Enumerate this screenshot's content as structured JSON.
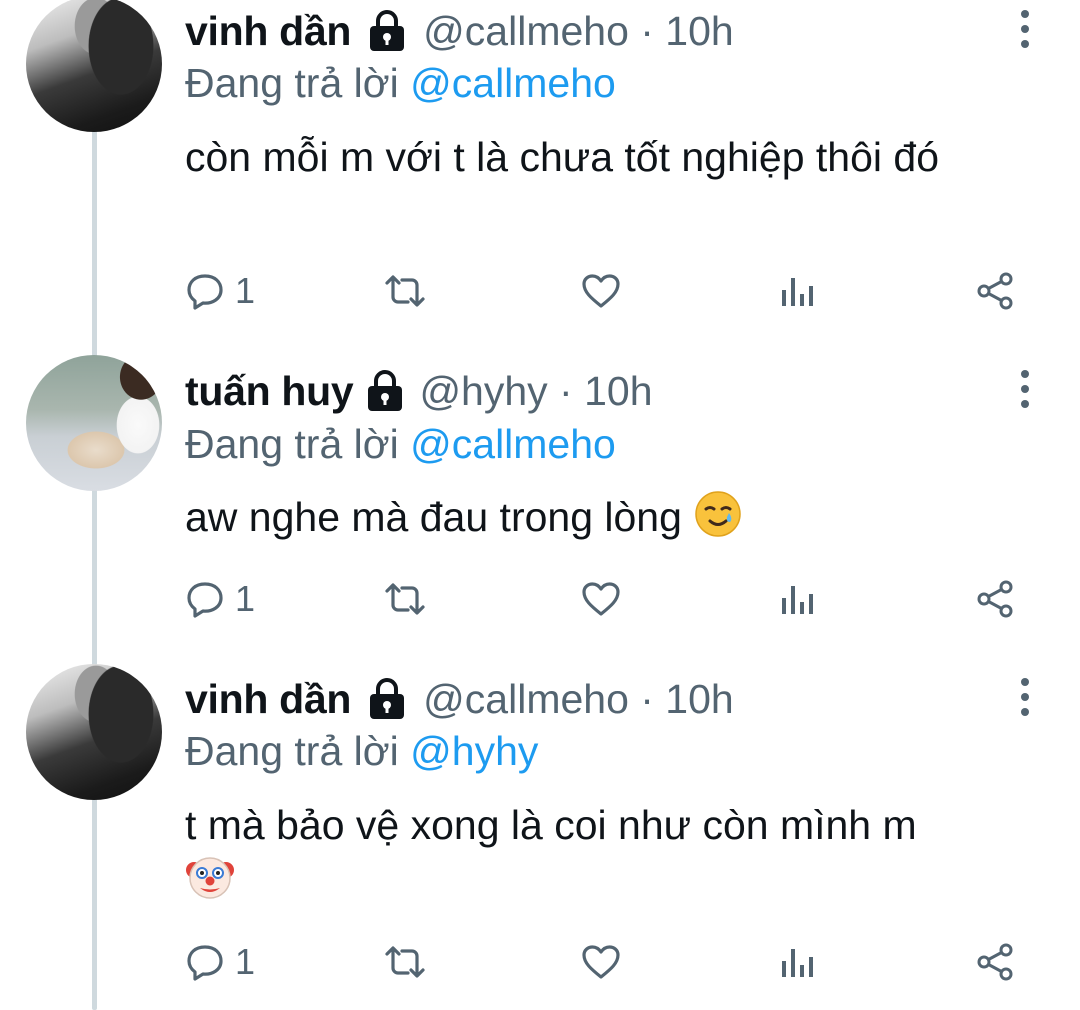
{
  "colors": {
    "text": "#0f1419",
    "secondary": "#536471",
    "accent": "#1d9bf0",
    "thread_line": "#cfd9de"
  },
  "tweets": [
    {
      "name": "vinh dần",
      "handle": "@callmeho · 10h",
      "replying_prefix": "Đang trả lời ",
      "replying_to": "@callmeho",
      "text": "còn mỗi m với t là chưa tốt nghiệp thôi đó",
      "emoji": "",
      "reply_count": "1",
      "avatar": "black-and-white-avatar",
      "locked": true
    },
    {
      "name": "tuấn huy",
      "handle": "@hyhy · 10h",
      "replying_prefix": "Đang trả lời ",
      "replying_to": "@callmeho",
      "text": "aw nghe mà đau trong lòng ",
      "emoji": "smiling-face-with-tear",
      "reply_count": "1",
      "avatar": "photo-avatar-with-cat",
      "locked": true
    },
    {
      "name": "vinh dần",
      "handle": "@callmeho · 10h",
      "replying_prefix": "Đang trả lời ",
      "replying_to": "@hyhy",
      "text": "t mà bảo vệ xong là coi như còn mình m",
      "emoji": "clown-face",
      "reply_count": "1",
      "avatar": "black-and-white-avatar",
      "locked": true
    }
  ],
  "icons": {
    "reply": "reply-icon",
    "retweet": "retweet-icon",
    "like": "heart-icon",
    "views": "analytics-icon",
    "share": "share-icon",
    "more": "more-vertical-icon",
    "lock": "lock-icon"
  }
}
